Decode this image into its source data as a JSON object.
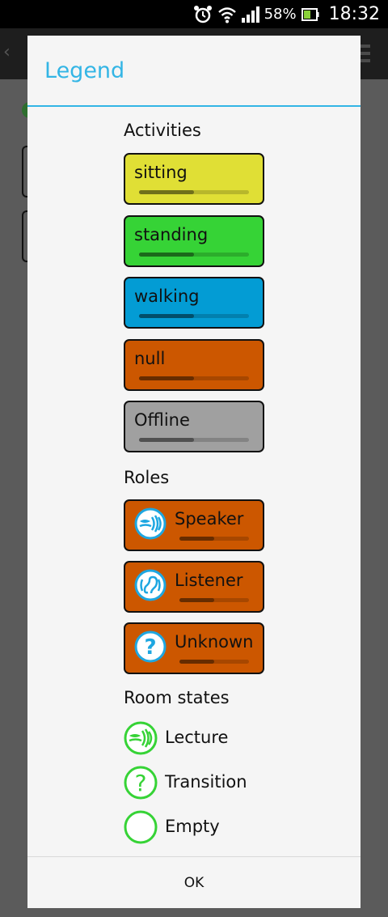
{
  "status_bar": {
    "battery_percent": "58%",
    "time": "18:32",
    "icons": [
      "alarm-icon",
      "wifi-icon",
      "signal-icon",
      "battery-icon"
    ]
  },
  "dialog": {
    "title": "Legend",
    "title_color": "#33b5e5",
    "ok_label": "OK"
  },
  "activities": {
    "heading": "Activities",
    "items": [
      {
        "label": "sitting",
        "color": "#e0df35",
        "progress": 0.5
      },
      {
        "label": "standing",
        "color": "#36d336",
        "progress": 0.5
      },
      {
        "label": "walking",
        "color": "#039cd4",
        "progress": 0.5
      },
      {
        "label": "null",
        "color": "#cc5700",
        "progress": 0.5
      },
      {
        "label": "Offline",
        "color": "#a0a0a0",
        "progress": 0.5
      }
    ]
  },
  "roles": {
    "heading": "Roles",
    "items": [
      {
        "label": "Speaker",
        "icon": "speaker-icon",
        "color": "#cc5700",
        "progress": 0.5
      },
      {
        "label": "Listener",
        "icon": "listener-ear-icon",
        "color": "#cc5700",
        "progress": 0.5
      },
      {
        "label": "Unknown",
        "icon": "question-icon",
        "color": "#cc5700",
        "progress": 0.5
      }
    ]
  },
  "room_states": {
    "heading": "Room states",
    "items": [
      {
        "label": "Lecture",
        "icon": "lecture-speaker-icon",
        "color": "#36d336"
      },
      {
        "label": "Transition",
        "icon": "question-circle-icon",
        "color": "#36d336"
      },
      {
        "label": "Empty",
        "icon": "empty-circle-icon",
        "color": "#36d336"
      }
    ]
  }
}
